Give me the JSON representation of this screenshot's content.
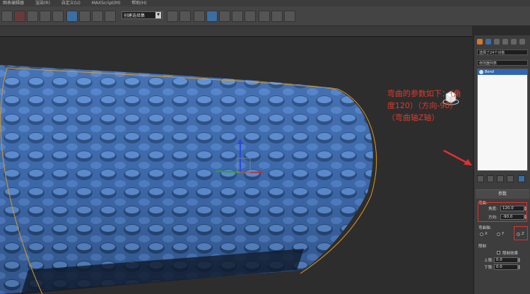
{
  "menubar": {
    "items": [
      "图表编辑器",
      "渲染(R)",
      "自定义(U)",
      "MAXScript(M)",
      "帮助(H)"
    ]
  },
  "toolbar": {
    "selection_set_label": "创建选择集"
  },
  "viewport": {
    "annotation": "弯曲的参数如下：（角度120）（方向-90）（弯曲轴Z轴）"
  },
  "panel": {
    "object_name": "选择了24个对象",
    "modifier_list_label": "修改器列表",
    "stack_items": [
      "Bend"
    ],
    "rollout_title": "参数",
    "bend_group_label": "弯曲:",
    "angle_label": "角度:",
    "angle_value": "120.0",
    "direction_label": "方向:",
    "direction_value": "-90.0",
    "axis_group_label": "弯曲轴:",
    "axis_options": [
      "X",
      "Y",
      "Z"
    ],
    "axis_selected": "Z",
    "limits_group_label": "限制",
    "limit_effect_label": "限制效果",
    "upper_limit_label": "上限:",
    "upper_limit_value": "0.0",
    "lower_limit_label": "下限:",
    "lower_limit_value": "0.0"
  },
  "colors": {
    "accent": "#3a6ea5",
    "annotation": "#e03a2a",
    "mesh": "#4a7bc0",
    "selection_outline": "#d89a2a"
  }
}
